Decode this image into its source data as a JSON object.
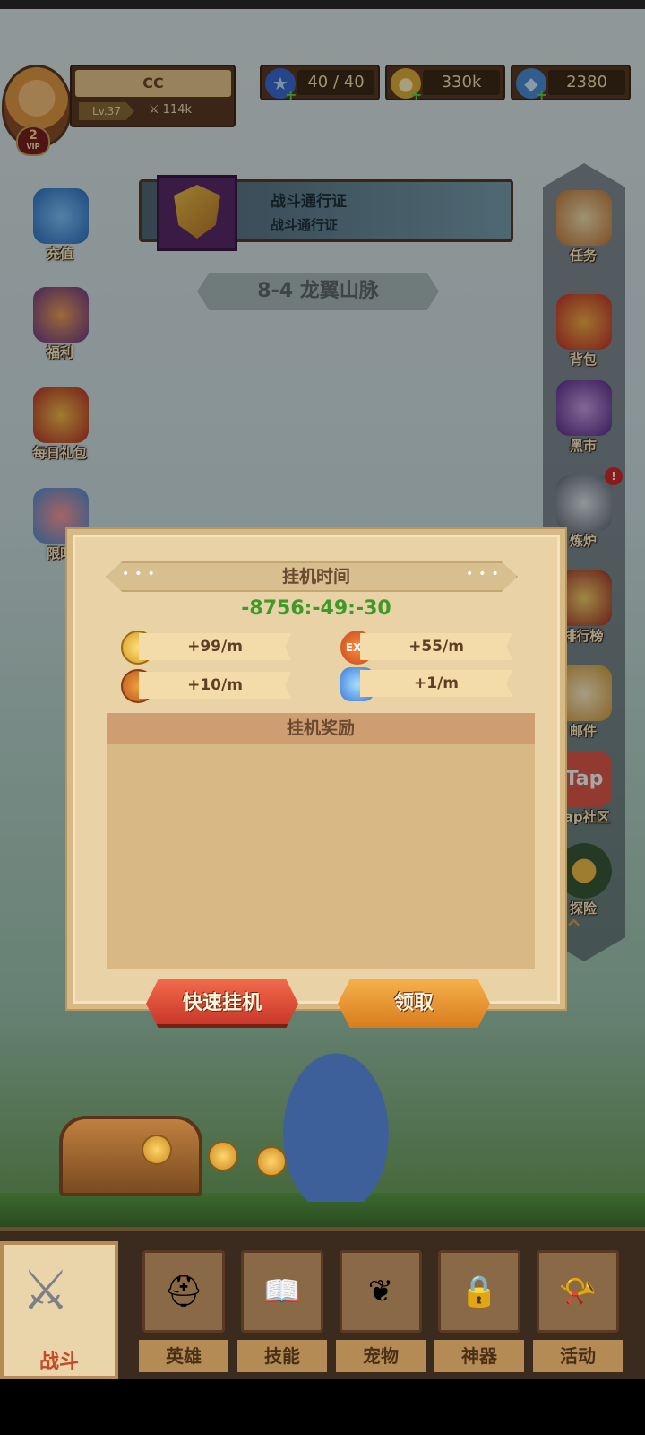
{
  "player": {
    "name": "CC",
    "level": "Lv.37",
    "power": "114k",
    "vip": "2",
    "vip_label": "VIP"
  },
  "resources": [
    {
      "name": "stamina",
      "icon": "star-icon",
      "value": "40 / 40"
    },
    {
      "name": "gold",
      "icon": "coin-icon",
      "value": "330k"
    },
    {
      "name": "gems",
      "icon": "gem-icon",
      "value": "2380"
    }
  ],
  "battle_pass": {
    "title": "战斗通行证",
    "subtitle": "战斗通行证"
  },
  "stage": "8-4 龙翼山脉",
  "left_menu": [
    {
      "label": "充值",
      "icon": "gem-pile-icon"
    },
    {
      "label": "福利",
      "icon": "welfare-icon"
    },
    {
      "label": "每日礼包",
      "icon": "gift-box-icon"
    },
    {
      "label": "限时",
      "icon": "limited-icon"
    }
  ],
  "right_menu": [
    {
      "label": "任务",
      "icon": "scroll-quill-icon"
    },
    {
      "label": "背包",
      "icon": "backpack-icon"
    },
    {
      "label": "黑市",
      "icon": "black-market-icon"
    },
    {
      "label": "炼炉",
      "icon": "anvil-icon",
      "badge": "!"
    },
    {
      "label": "排行榜",
      "icon": "trophy-icon"
    },
    {
      "label": "邮件",
      "icon": "mail-icon"
    },
    {
      "label": "Tap社区",
      "icon": "tap-icon"
    },
    {
      "label": "探险",
      "icon": "adventure-icon"
    }
  ],
  "idle_modal": {
    "title": "挂机时间",
    "timer": "-8756:-49:-30",
    "rates": [
      {
        "icon": "coin-icon",
        "value": "+99/m"
      },
      {
        "icon": "exp-icon",
        "icon_text": "EXP",
        "value": "+55/m"
      },
      {
        "icon": "medal-icon",
        "value": "+10/m"
      },
      {
        "icon": "crystal-icon",
        "value": "+1/m"
      }
    ],
    "reward_header": "挂机奖励",
    "quick_button": "快速挂机",
    "claim_button": "领取"
  },
  "bottom_nav": [
    {
      "label": "战斗",
      "icon": "crossed-swords-icon",
      "active": true
    },
    {
      "label": "英雄",
      "icon": "helmet-icon"
    },
    {
      "label": "技能",
      "icon": "spellbook-icon"
    },
    {
      "label": "宠物",
      "icon": "pet-icon"
    },
    {
      "label": "神器",
      "icon": "artifact-lock-icon"
    },
    {
      "label": "活动",
      "icon": "horn-icon"
    }
  ],
  "colors": {
    "timer": "#3d9a28",
    "modal_bg": "#e8d2a6",
    "quick_button": "#c9382a",
    "claim_button": "#d97c1e"
  }
}
